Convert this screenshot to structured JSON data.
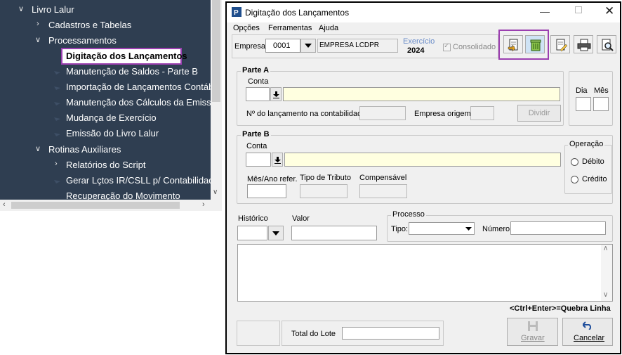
{
  "tree": {
    "root": "Livro Lalur",
    "cadastros": "Cadastros e Tabelas",
    "processamentos": "Processamentos",
    "items": [
      "Digitação dos Lançamentos",
      "Manutenção de Saldos - Parte B",
      "Importação de Lançamentos Contábe",
      "Manutenção dos Cálculos da Emissão",
      "Mudança de Exercício",
      "Emissão do Livro Lalur"
    ],
    "rotinas": "Rotinas Auxiliares",
    "relatorios": "Relatórios do Script",
    "gerar": "Gerar Lçtos IR/CSLL p/ Contabilidade",
    "recuperacao": "Recuperação do Movimento"
  },
  "dialog": {
    "title": "Digitação dos Lançamentos",
    "menu": [
      "Opções",
      "Ferramentas",
      "Ajuda"
    ],
    "empresa_label": "Empresa:",
    "empresa_code": "0001",
    "empresa_name": "EMPRESA LCDPR",
    "exercicio_label": "Exercício",
    "exercicio_value": "2024",
    "consolidado_label": "Consolidado",
    "parte_a": {
      "title": "Parte A",
      "conta_label": "Conta",
      "nlanc_label": "Nº do lançamento na contabilidade:",
      "empresa_origem_label": "Empresa origem:",
      "dividir_label": "Dividir"
    },
    "dia_label": "Dia",
    "mes_label": "Mês",
    "parte_b": {
      "title": "Parte B",
      "conta_label": "Conta",
      "mesano_label": "Mês/Ano refer.",
      "tipo_tributo_label": "Tipo de Tributo",
      "compensavel_label": "Compensável"
    },
    "operacao": {
      "title": "Operação",
      "debito": "Débito",
      "credito": "Crédito"
    },
    "historico_label": "Histórico",
    "valor_label": "Valor",
    "processo": {
      "title": "Processo",
      "tipo_label": "Tipo:",
      "numero_label": "Número:"
    },
    "hint": "<Ctrl+Enter>=Quebra Linha",
    "total_lote_label": "Total do Lote",
    "gravar_label": "Gravar",
    "cancelar_label": "Cancelar"
  },
  "colors": {
    "tree_bg": "#2f3e51",
    "highlight": "#9b3fb0",
    "yellow_field": "#ffffe0"
  }
}
